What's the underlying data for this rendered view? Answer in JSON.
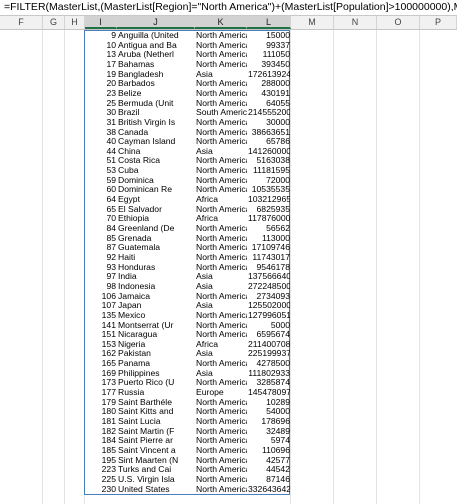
{
  "formula_bar": {
    "text": "=FILTER(MasterList,(MasterList[Region]=\"North America\")+(MasterList[Population]>100000000),MasterList)"
  },
  "column_headers": [
    "F",
    "G",
    "H",
    "I",
    "J",
    "K",
    "L",
    "M",
    "N",
    "O",
    "P"
  ],
  "selected_columns": [
    "I",
    "J",
    "K",
    "L"
  ],
  "rows": [
    {
      "id": "9",
      "country": "Anguilla (United",
      "region": "North America",
      "population": "15000"
    },
    {
      "id": "10",
      "country": "Antigua and Ba",
      "region": "North America",
      "population": "99337"
    },
    {
      "id": "13",
      "country": "Aruba (Netherl",
      "region": "North America",
      "population": "111050"
    },
    {
      "id": "17",
      "country": "Bahamas",
      "region": "North America",
      "population": "393450"
    },
    {
      "id": "19",
      "country": "Bangladesh",
      "region": "Asia",
      "population": "172613924"
    },
    {
      "id": "20",
      "country": "Barbados",
      "region": "North America",
      "population": "288000"
    },
    {
      "id": "23",
      "country": "Belize",
      "region": "North America",
      "population": "430191"
    },
    {
      "id": "25",
      "country": "Bermuda (Unit",
      "region": "North America",
      "population": "64055"
    },
    {
      "id": "30",
      "country": "Brazil",
      "region": "South America",
      "population": "214555200"
    },
    {
      "id": "31",
      "country": "British Virgin Is",
      "region": "North America",
      "population": "30000"
    },
    {
      "id": "38",
      "country": "Canada",
      "region": "North America",
      "population": "38663651"
    },
    {
      "id": "40",
      "country": "Cayman Island",
      "region": "North America",
      "population": "65786"
    },
    {
      "id": "44",
      "country": "China",
      "region": "Asia",
      "population": "1412600000"
    },
    {
      "id": "51",
      "country": "Costa Rica",
      "region": "North America",
      "population": "5163038"
    },
    {
      "id": "53",
      "country": "Cuba",
      "region": "North America",
      "population": "11181595"
    },
    {
      "id": "59",
      "country": "Dominica",
      "region": "North America",
      "population": "72000"
    },
    {
      "id": "60",
      "country": "Dominican Re",
      "region": "North America",
      "population": "10535535"
    },
    {
      "id": "64",
      "country": "Egypt",
      "region": "Africa",
      "population": "103212965"
    },
    {
      "id": "65",
      "country": "El Salvador",
      "region": "North America",
      "population": "6825935"
    },
    {
      "id": "70",
      "country": "Ethiopia",
      "region": "Africa",
      "population": "117876000"
    },
    {
      "id": "84",
      "country": "Greenland (De",
      "region": "North America",
      "population": "56562"
    },
    {
      "id": "85",
      "country": "Grenada",
      "region": "North America",
      "population": "113000"
    },
    {
      "id": "87",
      "country": "Guatemala",
      "region": "North America",
      "population": "17109746"
    },
    {
      "id": "92",
      "country": "Haiti",
      "region": "North America",
      "population": "11743017"
    },
    {
      "id": "93",
      "country": "Honduras",
      "region": "North America",
      "population": "9546178"
    },
    {
      "id": "97",
      "country": "India",
      "region": "Asia",
      "population": "1375666400"
    },
    {
      "id": "98",
      "country": "Indonesia",
      "region": "Asia",
      "population": "272248500"
    },
    {
      "id": "106",
      "country": "Jamaica",
      "region": "North America",
      "population": "2734093"
    },
    {
      "id": "107",
      "country": "Japan",
      "region": "Asia",
      "population": "125502000"
    },
    {
      "id": "135",
      "country": "Mexico",
      "region": "North America",
      "population": "127996051"
    },
    {
      "id": "141",
      "country": "Montserrat (Ur",
      "region": "North America",
      "population": "5000"
    },
    {
      "id": "151",
      "country": "Nicaragua",
      "region": "North America",
      "population": "6595674"
    },
    {
      "id": "153",
      "country": "Nigeria",
      "region": "Africa",
      "population": "211400708"
    },
    {
      "id": "162",
      "country": "Pakistan",
      "region": "Asia",
      "population": "225199937"
    },
    {
      "id": "165",
      "country": "Panama",
      "region": "North America",
      "population": "4278500"
    },
    {
      "id": "169",
      "country": "Philippines",
      "region": "Asia",
      "population": "111802933"
    },
    {
      "id": "173",
      "country": "Puerto Rico (U",
      "region": "North America",
      "population": "3285874"
    },
    {
      "id": "177",
      "country": "Russia",
      "region": "Europe",
      "population": "145478097"
    },
    {
      "id": "179",
      "country": "Saint Barthéle",
      "region": "North America",
      "population": "10289"
    },
    {
      "id": "180",
      "country": "Saint Kitts and",
      "region": "North America",
      "population": "54000"
    },
    {
      "id": "181",
      "country": "Saint Lucia",
      "region": "North America",
      "population": "178696"
    },
    {
      "id": "182",
      "country": "Saint Martin (F",
      "region": "North America",
      "population": "32489"
    },
    {
      "id": "184",
      "country": "Saint Pierre ar",
      "region": "North America",
      "population": "5974"
    },
    {
      "id": "185",
      "country": "Saint Vincent a",
      "region": "North America",
      "population": "110696"
    },
    {
      "id": "195",
      "country": "Sint Maarten (N",
      "region": "North America",
      "population": "42577"
    },
    {
      "id": "223",
      "country": "Turks and Cai",
      "region": "North America",
      "population": "44542"
    },
    {
      "id": "225",
      "country": "U.S. Virgin Isla",
      "region": "North America",
      "population": "87146"
    },
    {
      "id": "230",
      "country": "United States",
      "region": "North America",
      "population": "332643642"
    }
  ]
}
